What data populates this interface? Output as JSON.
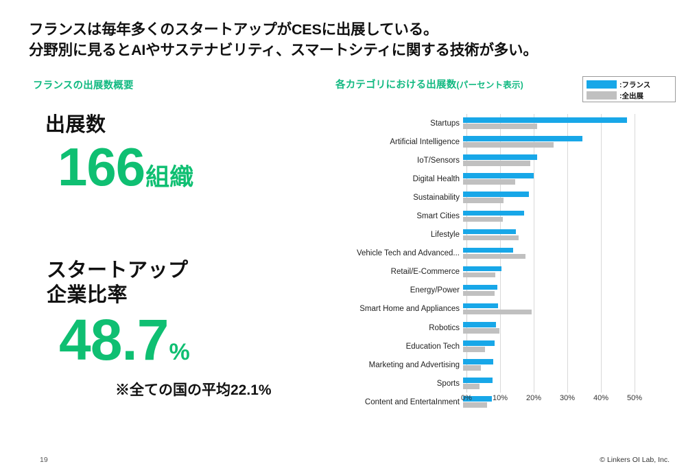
{
  "slide": {
    "title_line1": "フランスは毎年多くのスタートアップがCESに出展している。",
    "title_line2": "分野別に見るとAIやサステナビリティ、スマートシティに関する技術が多い。"
  },
  "sections": {
    "left_heading": "フランスの出展数概要",
    "right_heading_main": "各カテゴリにおける出展数",
    "right_heading_paren": "(パーセント表示)"
  },
  "legend": {
    "france_label": ":フランス",
    "total_label": ":全出展",
    "france_color": "#18a7e8",
    "total_color": "#c0c0c0"
  },
  "kpi": {
    "exhibitors": {
      "label": "出展数",
      "value": "166",
      "unit": "組織"
    },
    "ratio": {
      "label_line1": "スタートアップ",
      "label_line2": "企業比率",
      "value": "48.7",
      "unit": "%"
    },
    "note": "※全ての国の平均22.1%",
    "accent_color": "#0fbf72"
  },
  "footer": {
    "page_number": "19",
    "copyright": "© Linkers OI Lab, Inc."
  },
  "chart_data": {
    "type": "bar",
    "orientation": "horizontal",
    "title": "各カテゴリにおける出展数(パーセント表示)",
    "xlabel": "",
    "ylabel": "",
    "xlim": [
      0,
      50
    ],
    "xticks": [
      0,
      10,
      20,
      30,
      40,
      50
    ],
    "xticklabels": [
      "0%",
      "10%",
      "20%",
      "30%",
      "40%",
      "50%"
    ],
    "grid": true,
    "legend_position": "top-right",
    "categories": [
      "Startups",
      "Artificial Intelligence",
      "IoT/Sensors",
      "Digital Health",
      "Sustainability",
      "Smart Cities",
      "Lifestyle",
      "Vehicle Tech and Advanced...",
      "Retail/E-Commerce",
      "Energy/Power",
      "Smart Home and Appliances",
      "Robotics",
      "Education Tech",
      "Marketing and Advertising",
      "Sports",
      "Content and EntertaInment"
    ],
    "series": [
      {
        "name": ":フランス",
        "color": "#18a7e8",
        "values": [
          48.7,
          35.5,
          22.0,
          21.0,
          19.5,
          18.2,
          15.8,
          14.8,
          11.5,
          10.2,
          10.5,
          9.8,
          9.3,
          9.0,
          8.7,
          8.6
        ]
      },
      {
        "name": ":全出展",
        "color": "#c0c0c0",
        "values": [
          22.1,
          27.0,
          20.0,
          15.5,
          12.0,
          11.8,
          16.5,
          18.5,
          9.5,
          9.4,
          20.5,
          10.8,
          6.5,
          5.4,
          4.8,
          7.2
        ]
      }
    ]
  }
}
